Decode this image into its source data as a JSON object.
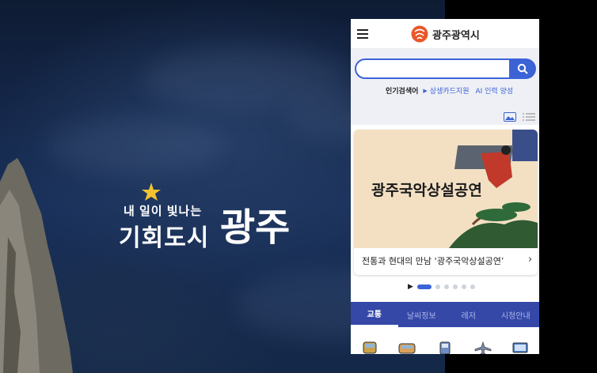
{
  "hero": {
    "slogan_line1": "내 일이 빛나는",
    "slogan_line2": "기회도시",
    "city": "광주"
  },
  "phone": {
    "header": {
      "brand_name": "광주광역시",
      "menu_icon": "hamburger-menu-icon",
      "logo_icon": "gwangju-logo-icon"
    },
    "search": {
      "placeholder": "",
      "button_icon": "search-icon",
      "popular_label": "인기검색어",
      "keywords": [
        "상생카드지원",
        "AI 인력 양성"
      ]
    },
    "view_toggle": [
      "image-view-icon",
      "list-view-icon"
    ],
    "banner": {
      "art_title": "광주국악상설공연",
      "caption": "전통과 현대의 만남 ‘광주국악상설공연’",
      "next_icon": "chevron-right-icon"
    },
    "pager": {
      "play_icon": "play-icon",
      "total": 6,
      "active_index": 0
    },
    "tabs": [
      {
        "label": "교통",
        "active": true
      },
      {
        "label": "날씨정보",
        "active": false
      },
      {
        "label": "레저",
        "active": false
      },
      {
        "label": "시청안내",
        "active": false
      }
    ],
    "quick_icons": [
      "bus-icon",
      "train-icon",
      "subway-icon",
      "airplane-icon",
      "monitor-icon"
    ]
  },
  "colors": {
    "accent": "#3c63d6",
    "tab_bar": "#3548a8",
    "brand_orange": "#e8572a",
    "background": "#0f1e36"
  }
}
